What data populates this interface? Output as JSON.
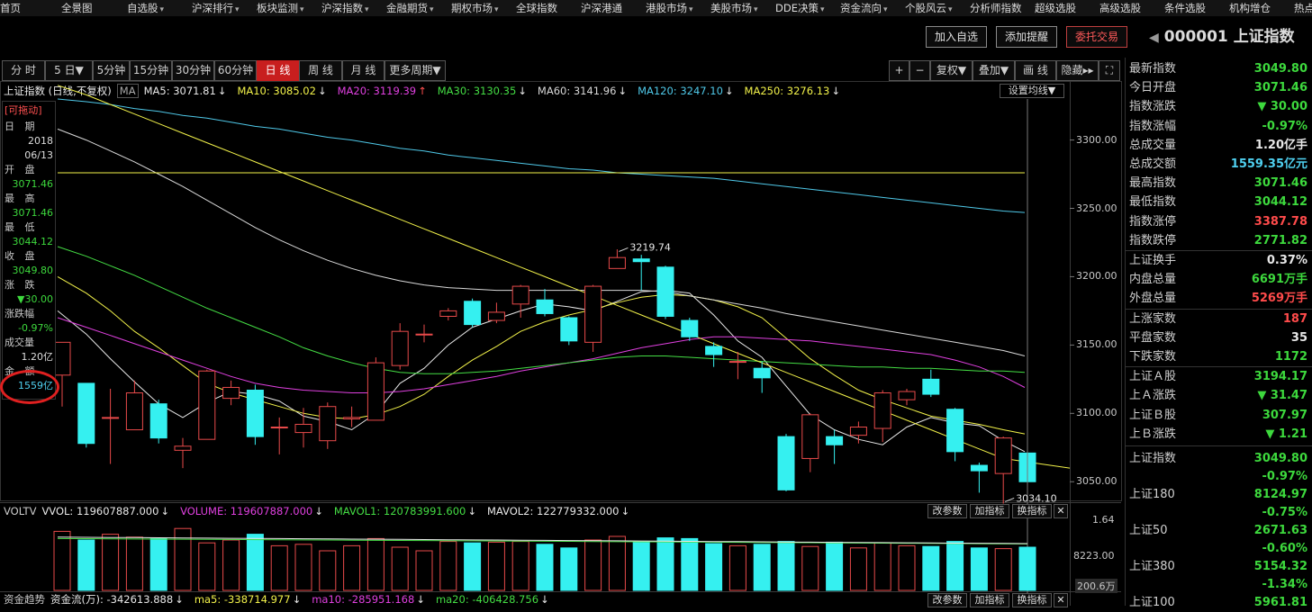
{
  "nav": {
    "items": [
      {
        "label": "首页",
        "arrow": false
      },
      {
        "label": "全景图",
        "arrow": false
      },
      {
        "label": "自选股",
        "arrow": true
      },
      {
        "label": "沪深排行",
        "arrow": true
      },
      {
        "label": "板块监测",
        "arrow": true
      },
      {
        "label": "沪深指数",
        "arrow": true
      },
      {
        "label": "金融期货",
        "arrow": true
      },
      {
        "label": "期权市场",
        "arrow": true
      },
      {
        "label": "全球指数",
        "arrow": false
      },
      {
        "label": "沪深港通",
        "arrow": false
      },
      {
        "label": "港股市场",
        "arrow": true
      },
      {
        "label": "美股市场",
        "arrow": true
      },
      {
        "label": "DDE决策",
        "arrow": true
      },
      {
        "label": "资金流向",
        "arrow": true
      },
      {
        "label": "个股风云",
        "arrow": true
      },
      {
        "label": "分析师指数",
        "arrow": false
      },
      {
        "label": "超级选股",
        "arrow": false
      },
      {
        "label": "高级选股",
        "arrow": false
      },
      {
        "label": "条件选股",
        "arrow": false
      },
      {
        "label": "机构增仓",
        "arrow": false
      },
      {
        "label": "热点",
        "arrow": false
      }
    ]
  },
  "actions": {
    "add_watch": "加入自选",
    "add_alert": "添加提醒",
    "trade": "委托交易"
  },
  "stock": {
    "code": "000001",
    "name": "上证指数"
  },
  "toolbar": {
    "periods": [
      "分 时",
      "5 日▼",
      "5分钟",
      "15分钟",
      "30分钟",
      "60分钟",
      "日 线",
      "周 线",
      "月 线",
      "更多周期▼"
    ],
    "active": "日 线",
    "right": [
      "+",
      "−",
      "复权▼",
      "叠加▼",
      "画 线",
      "隐藏▸▸",
      "⛶"
    ]
  },
  "ma_line": {
    "label": "上证指数 (日线,不复权)",
    "ma_icon": "MA",
    "items": [
      {
        "text": "MA5: 3071.81",
        "arrow": "↓",
        "color": "#e8e8e8"
      },
      {
        "text": "MA10: 3085.02",
        "arrow": "↓",
        "color": "#f2f24a"
      },
      {
        "text": "MA20: 3119.39",
        "arrow": "↑",
        "color": "#e040e0"
      },
      {
        "text": "MA30: 3130.35",
        "arrow": "↓",
        "color": "#44dd44"
      },
      {
        "text": "MA60: 3141.96",
        "arrow": "↓",
        "color": "#d8d8d8"
      },
      {
        "text": "MA120: 3247.10",
        "arrow": "↓",
        "color": "#4fc8e8"
      },
      {
        "text": "MA250: 3276.13",
        "arrow": "↓",
        "color": "#f2f24a"
      }
    ],
    "settings": "设置均线▼"
  },
  "infobox": {
    "draggable": "[可拖动]",
    "date_label": "日 期",
    "year": "2018",
    "date": "06/13",
    "open_label": "开 盘",
    "open": "3071.46",
    "high_label": "最 高",
    "high": "3071.46",
    "low_label": "最 低",
    "low": "3044.12",
    "close_label": "收 盘",
    "close": "3049.80",
    "change_label": "涨 跌",
    "change": "▼30.00",
    "pct_label": "涨跌幅",
    "pct": "-0.97%",
    "vol_label": "成交量",
    "vol": "1.20亿",
    "amount_label": "金 额",
    "amount": "1559亿"
  },
  "chart_data": {
    "type": "candlestick",
    "price_axis_ticks": [
      "3300.00",
      "3250.00",
      "3200.00",
      "3150.00",
      "3100.00",
      "3050.00"
    ],
    "ylim": [
      3037,
      3330
    ],
    "annotations": {
      "high": "3219.74",
      "low": "3034.10"
    },
    "candles": [
      {
        "o": 3128,
        "c": 3152,
        "h": 3152,
        "l": 3105
      },
      {
        "o": 3122,
        "c": 3078,
        "h": 3122,
        "l": 3075
      },
      {
        "o": 3097,
        "c": 3097,
        "h": 3118,
        "l": 3063
      },
      {
        "o": 3088,
        "c": 3115,
        "h": 3124,
        "l": 3088
      },
      {
        "o": 3107,
        "c": 3082,
        "h": 3110,
        "l": 3078
      },
      {
        "o": 3073,
        "c": 3076,
        "h": 3082,
        "l": 3060
      },
      {
        "o": 3081,
        "c": 3131,
        "h": 3132,
        "l": 3081
      },
      {
        "o": 3111,
        "c": 3119,
        "h": 3124,
        "l": 3106
      },
      {
        "o": 3117,
        "c": 3083,
        "h": 3121,
        "l": 3077
      },
      {
        "o": 3090,
        "c": 3090,
        "h": 3097,
        "l": 3070
      },
      {
        "o": 3086,
        "c": 3092,
        "h": 3104,
        "l": 3075
      },
      {
        "o": 3080,
        "c": 3105,
        "h": 3108,
        "l": 3074
      },
      {
        "o": 3096,
        "c": 3097,
        "h": 3105,
        "l": 3090
      },
      {
        "o": 3095,
        "c": 3137,
        "h": 3141,
        "l": 3095
      },
      {
        "o": 3135,
        "c": 3160,
        "h": 3166,
        "l": 3132
      },
      {
        "o": 3158,
        "c": 3158,
        "h": 3165,
        "l": 3152
      },
      {
        "o": 3171,
        "c": 3175,
        "h": 3177,
        "l": 3168
      },
      {
        "o": 3182,
        "c": 3165,
        "h": 3184,
        "l": 3163
      },
      {
        "o": 3168,
        "c": 3174,
        "h": 3181,
        "l": 3166
      },
      {
        "o": 3180,
        "c": 3193,
        "h": 3194,
        "l": 3170
      },
      {
        "o": 3183,
        "c": 3173,
        "h": 3191,
        "l": 3171
      },
      {
        "o": 3170,
        "c": 3153,
        "h": 3171,
        "l": 3150
      },
      {
        "o": 3152,
        "c": 3193,
        "h": 3194,
        "l": 3145
      },
      {
        "o": 3206,
        "c": 3214,
        "h": 3220,
        "l": 3206
      },
      {
        "o": 3213,
        "c": 3211,
        "h": 3216,
        "l": 3190
      },
      {
        "o": 3207,
        "c": 3171,
        "h": 3208,
        "l": 3169
      },
      {
        "o": 3168,
        "c": 3156,
        "h": 3170,
        "l": 3153
      },
      {
        "o": 3149,
        "c": 3143,
        "h": 3152,
        "l": 3134
      },
      {
        "o": 3138,
        "c": 3138,
        "h": 3145,
        "l": 3125
      },
      {
        "o": 3133,
        "c": 3126,
        "h": 3138,
        "l": 3115
      },
      {
        "o": 3083,
        "c": 3044,
        "h": 3085,
        "l": 3043
      },
      {
        "o": 3067,
        "c": 3099,
        "h": 3100,
        "l": 3057
      },
      {
        "o": 3083,
        "c": 3077,
        "h": 3088,
        "l": 3063
      },
      {
        "o": 3084,
        "c": 3090,
        "h": 3094,
        "l": 3078
      },
      {
        "o": 3089,
        "c": 3115,
        "h": 3117,
        "l": 3079
      },
      {
        "o": 3110,
        "c": 3116,
        "h": 3118,
        "l": 3106
      },
      {
        "o": 3125,
        "c": 3114,
        "h": 3132,
        "l": 3112
      },
      {
        "o": 3103,
        "c": 3072,
        "h": 3104,
        "l": 3065
      },
      {
        "o": 3062,
        "c": 3058,
        "h": 3064,
        "l": 3042
      },
      {
        "o": 3056,
        "c": 3082,
        "h": 3083,
        "l": 3034
      },
      {
        "o": 3071,
        "c": 3050,
        "h": 3071,
        "l": 3044
      }
    ],
    "ma_series": [
      {
        "name": "MA5",
        "color": "#e8e8e8",
        "values": [
          3175,
          3158,
          3140,
          3123,
          3107,
          3097,
          3108,
          3116,
          3114,
          3109,
          3098,
          3094,
          3088,
          3100,
          3122,
          3133,
          3150,
          3163,
          3169,
          3175,
          3180,
          3178,
          3175,
          3182,
          3189,
          3190,
          3188,
          3172,
          3153,
          3141,
          3120,
          3099,
          3088,
          3081,
          3077,
          3090,
          3097,
          3093,
          3091,
          3080,
          3072
        ]
      },
      {
        "name": "MA10",
        "color": "#f2f24a",
        "values": [
          3200,
          3188,
          3175,
          3160,
          3148,
          3135,
          3122,
          3115,
          3110,
          3105,
          3100,
          3097,
          3096,
          3099,
          3105,
          3114,
          3127,
          3139,
          3149,
          3160,
          3167,
          3172,
          3176,
          3181,
          3185,
          3187,
          3186,
          3183,
          3178,
          3170,
          3155,
          3140,
          3128,
          3117,
          3110,
          3104,
          3098,
          3095,
          3092,
          3088,
          3085
        ]
      },
      {
        "name": "MA20",
        "color": "#e040e0",
        "values": [
          3170,
          3163,
          3157,
          3151,
          3145,
          3139,
          3133,
          3127,
          3122,
          3119,
          3117,
          3116,
          3115,
          3115,
          3116,
          3118,
          3121,
          3124,
          3127,
          3131,
          3134,
          3137,
          3140,
          3144,
          3148,
          3151,
          3154,
          3156,
          3156,
          3155,
          3154,
          3153,
          3151,
          3149,
          3147,
          3145,
          3143,
          3139,
          3134,
          3127,
          3119
        ]
      },
      {
        "name": "MA30",
        "color": "#44dd44",
        "values": [
          3222,
          3215,
          3208,
          3201,
          3193,
          3185,
          3177,
          3170,
          3163,
          3156,
          3148,
          3142,
          3137,
          3133,
          3130,
          3129,
          3129,
          3130,
          3131,
          3133,
          3135,
          3137,
          3139,
          3141,
          3142,
          3142,
          3141,
          3140,
          3139,
          3138,
          3137,
          3136,
          3135,
          3134,
          3134,
          3133,
          3133,
          3132,
          3131,
          3131,
          3130
        ]
      },
      {
        "name": "MA60",
        "color": "#d8d8d8",
        "values": [
          3308,
          3300,
          3292,
          3284,
          3275,
          3266,
          3256,
          3246,
          3236,
          3227,
          3219,
          3212,
          3206,
          3201,
          3197,
          3194,
          3192,
          3191,
          3190,
          3190,
          3190,
          3190,
          3190,
          3190,
          3190,
          3189,
          3186,
          3183,
          3180,
          3177,
          3173,
          3170,
          3167,
          3164,
          3161,
          3158,
          3155,
          3152,
          3149,
          3146,
          3142
        ]
      },
      {
        "name": "MA120",
        "color": "#4fc8e8",
        "values": [
          3330,
          3328,
          3326,
          3323,
          3321,
          3318,
          3316,
          3313,
          3310,
          3308,
          3305,
          3302,
          3300,
          3297,
          3294,
          3292,
          3289,
          3287,
          3285,
          3283,
          3281,
          3279,
          3278,
          3276,
          3275,
          3274,
          3273,
          3272,
          3270,
          3268,
          3266,
          3264,
          3262,
          3260,
          3258,
          3256,
          3254,
          3252,
          3250,
          3248,
          3247
        ]
      },
      {
        "name": "MA250",
        "color": "#f2f24a",
        "values": [
          3276,
          3276,
          3276,
          3276,
          3276,
          3276,
          3276,
          3276,
          3276,
          3276,
          3276,
          3276,
          3276,
          3276,
          3276,
          3276,
          3276,
          3276,
          3276,
          3276,
          3276,
          3276,
          3276,
          3276,
          3276,
          3276,
          3276,
          3276,
          3276,
          3276,
          3276,
          3276,
          3276,
          3276,
          3276,
          3276,
          3276,
          3276,
          3276,
          3276,
          3276
        ]
      },
      {
        "name": "TREND",
        "color": "#f2f24a",
        "values": [
          3340,
          3333,
          3326,
          3319,
          3312,
          3305,
          3298,
          3291,
          3284,
          3277,
          3270,
          3263,
          3256,
          3249,
          3242,
          3235,
          3228,
          3221,
          3214,
          3207,
          3200,
          3193,
          3186,
          3179,
          3172,
          3165,
          3158,
          3151,
          3144,
          3137,
          3130,
          3123,
          3116,
          3109,
          3102,
          3095,
          3088,
          3081,
          3074,
          3067,
          3060
        ]
      }
    ],
    "volume_bars": [
      0.82,
      0.7,
      0.78,
      0.74,
      0.72,
      0.86,
      0.66,
      0.7,
      0.78,
      0.62,
      0.64,
      0.55,
      0.62,
      0.72,
      0.6,
      0.55,
      0.68,
      0.66,
      0.67,
      0.68,
      0.64,
      0.59,
      0.7,
      0.75,
      0.68,
      0.73,
      0.72,
      0.65,
      0.62,
      0.64,
      0.68,
      0.61,
      0.67,
      0.59,
      0.66,
      0.62,
      0.61,
      0.68,
      0.59,
      0.58,
      0.6
    ],
    "volume_axis": [
      "1.64",
      "8223.00",
      "200.6万"
    ]
  },
  "volume_line": {
    "label": "VOLTV",
    "items": [
      {
        "text": "VVOL: 119607887.000",
        "arrow": "↓",
        "color": "#e8e8e8"
      },
      {
        "text": "VOLUME: 119607887.000",
        "arrow": "↓",
        "color": "#e040e0"
      },
      {
        "text": "MAVOL1: 120783991.600",
        "arrow": "↓",
        "color": "#44dd44"
      },
      {
        "text": "MAVOL2: 122779332.000",
        "arrow": "↓",
        "color": "#e8e8e8"
      }
    ]
  },
  "fund_line": {
    "label": "资金趋势",
    "items": [
      {
        "text": "资金流(万): -342613.888",
        "arrow": "↓",
        "color": "#e8e8e8"
      },
      {
        "text": "ma5: -338714.977",
        "arrow": "↓",
        "color": "#f2f24a"
      },
      {
        "text": "ma10: -285951.168",
        "arrow": "↓",
        "color": "#e040e0"
      },
      {
        "text": "ma20: -406428.756",
        "arrow": "↓",
        "color": "#44dd44"
      }
    ]
  },
  "panel_buttons": {
    "modify": "改参数",
    "add": "加指标",
    "swap": "换指标",
    "close": "✕"
  },
  "right_panel": {
    "rows": [
      {
        "k": "最新指数",
        "v": "3049.80",
        "c": "#3dd93d"
      },
      {
        "k": "今日开盘",
        "v": "3071.46",
        "c": "#3dd93d"
      },
      {
        "k": "指数涨跌",
        "v": "▼ 30.00",
        "c": "#3dd93d"
      },
      {
        "k": "指数涨幅",
        "v": "-0.97%",
        "c": "#3dd93d"
      },
      {
        "k": "总成交量",
        "v": "1.20亿手",
        "c": "#e8e8e8"
      },
      {
        "k": "总成交额",
        "v": "1559.35亿元",
        "c": "#4fd0f0"
      },
      {
        "k": "最高指数",
        "v": "3071.46",
        "c": "#3dd93d"
      },
      {
        "k": "最低指数",
        "v": "3044.12",
        "c": "#3dd93d"
      },
      {
        "k": "指数涨停",
        "v": "3387.78",
        "c": "#ff4b4b"
      },
      {
        "k": "指数跌停",
        "v": "2771.82",
        "c": "#3dd93d"
      },
      {
        "k": "上证换手",
        "v": "0.37%",
        "c": "#e8e8e8"
      },
      {
        "k": "内盘总量",
        "v": "6691万手",
        "c": "#3dd93d"
      },
      {
        "k": "外盘总量",
        "v": "5269万手",
        "c": "#ff4b4b"
      },
      {
        "k": "上涨家数",
        "v": "187",
        "c": "#ff4b4b"
      },
      {
        "k": "平盘家数",
        "v": "35",
        "c": "#e8e8e8"
      },
      {
        "k": "下跌家数",
        "v": "1172",
        "c": "#3dd93d"
      },
      {
        "k": "上证Ａ股",
        "v": "3194.17",
        "c": "#3dd93d"
      },
      {
        "k": "上Ａ涨跌",
        "v": "▼ 31.47",
        "c": "#3dd93d"
      },
      {
        "k": "上证Ｂ股",
        "v": "307.97",
        "c": "#3dd93d"
      },
      {
        "k": "上Ｂ涨跌",
        "v": "▼ 1.21",
        "c": "#3dd93d"
      }
    ],
    "indices": [
      {
        "k": "上证指数",
        "v": "3049.80",
        "p": "-0.97%"
      },
      {
        "k": "上证180",
        "v": "8124.97",
        "p": "-0.75%"
      },
      {
        "k": "上证50",
        "v": "2671.63",
        "p": "-0.60%"
      },
      {
        "k": "上证380",
        "v": "5154.32",
        "p": "-1.34%"
      },
      {
        "k": "上证100",
        "v": "5961.81",
        "p": ""
      }
    ],
    "idx_color": "#3dd93d"
  }
}
